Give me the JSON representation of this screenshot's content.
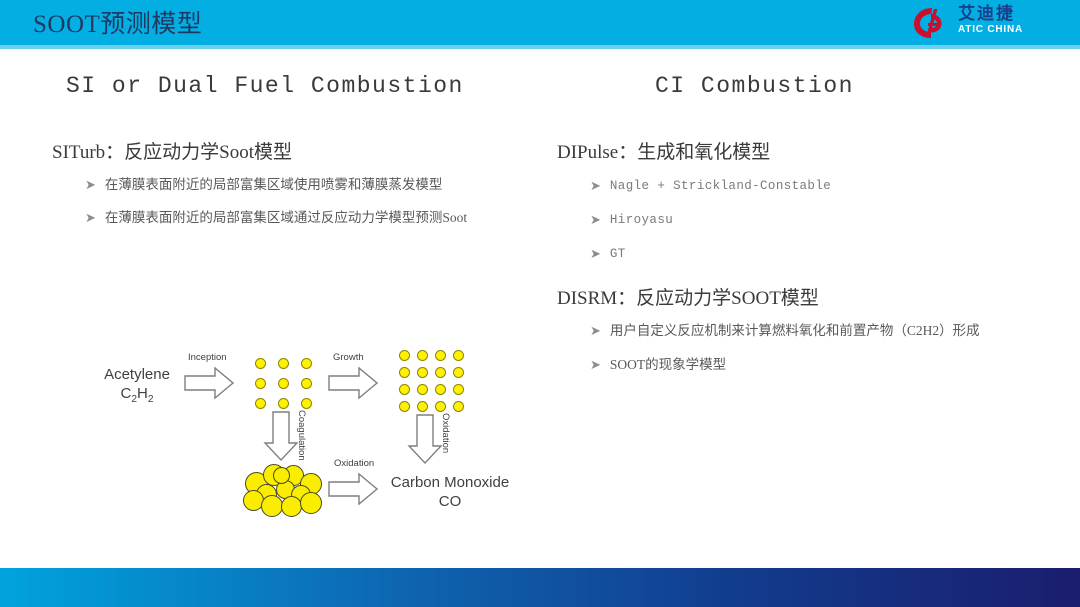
{
  "header": {
    "title": "SOOT预测模型",
    "bar_color": "#03AFE2",
    "title_color": "#1F3864",
    "logo": {
      "mark_name": "ad-monogram-logo-icon",
      "mark_color": "#C8102E",
      "chinese_name": "艾迪捷",
      "english_name": "ATIC CHINA"
    }
  },
  "columns": {
    "left": {
      "heading": "SI or Dual Fuel Combustion",
      "model": {
        "title": "SITurb：反应动力学Soot模型",
        "bullets": [
          "在薄膜表面附近的局部富集区域使用喷雾和薄膜蒸发模型",
          "在薄膜表面附近的局部富集区域通过反应动力学模型预测Soot"
        ]
      }
    },
    "right": {
      "heading": "CI Combustion",
      "models": [
        {
          "title": "DIPulse：生成和氧化模型",
          "bullets": [
            "Nagle + Strickland-Constable",
            "Hiroyasu",
            "GT"
          ]
        },
        {
          "title": "DISRM：反应动力学SOOT模型",
          "bullets": [
            "用户自定义反应机制来计算燃料氧化和前置产物（C2H2）形成",
            "SOOT的现象学模型"
          ]
        }
      ]
    }
  },
  "diagram": {
    "name": "soot-formation-process-diagram",
    "reactant_line1": "Acetylene",
    "reactant_formula_main": "C",
    "reactant_formula_sub1": "2",
    "reactant_formula_mid": "H",
    "reactant_formula_sub2": "2",
    "step_inception": "Inception",
    "step_growth": "Growth",
    "step_coagulation": "Coagulation",
    "step_oxidation_right": "Oxidation",
    "step_oxidation_bottom": "Oxidation",
    "product_line1": "Carbon Monoxide",
    "product_line2": "CO",
    "particle_color": "#FFF200",
    "particle_outline": "#8F8400",
    "nuclei_grid": "3x3",
    "grown_grid": "4x4",
    "agglomerate_count": 12
  },
  "footer": {
    "gradient_from": "#00A3DE",
    "gradient_to": "#1B1D6E"
  }
}
